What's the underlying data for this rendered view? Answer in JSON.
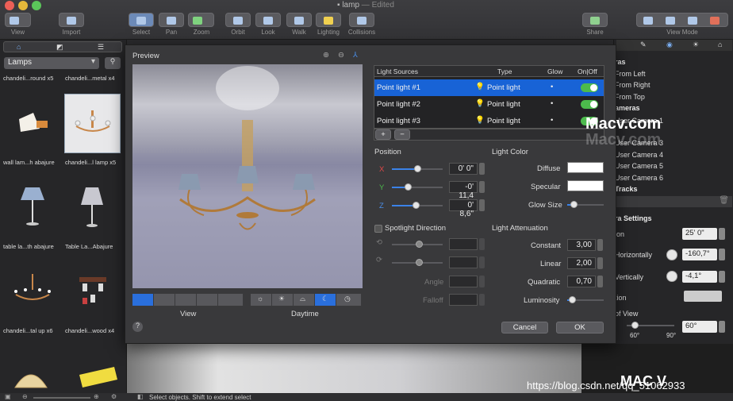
{
  "window": {
    "title": "lamp",
    "subtitle": "— Edited"
  },
  "toolbar": {
    "view": "View",
    "import": "Import",
    "select": "Select",
    "pan": "Pan",
    "zoom": "Zoom",
    "orbit": "Orbit",
    "look": "Look",
    "walk": "Walk",
    "lighting": "Lighting",
    "collisions": "Collisions",
    "share": "Share",
    "view_mode": "View Mode"
  },
  "library": {
    "category": "Lamps",
    "search_icon": "search-icon",
    "items": [
      {
        "label": "chandeli...round x5"
      },
      {
        "label": "chandeli...metal x4"
      },
      {
        "label": "wall lam...h abajure"
      },
      {
        "label": "chandeli...l lamp x5"
      },
      {
        "label": "table la...th abajure"
      },
      {
        "label": "Table La...Abajure"
      },
      {
        "label": "chandeli...tal up x6"
      },
      {
        "label": "chandeli...wood x4"
      }
    ]
  },
  "dialog": {
    "preview_label": "Preview",
    "list": {
      "headers": {
        "sources": "Light Sources",
        "type": "Type",
        "glow": "Glow",
        "onoff": "On|Off"
      },
      "rows": [
        {
          "name": "Point light #1",
          "type": "Point light"
        },
        {
          "name": "Point light #2",
          "type": "Point light"
        },
        {
          "name": "Point light #3",
          "type": "Point light"
        }
      ],
      "add": "+",
      "remove": "−"
    },
    "position": {
      "label": "Position",
      "x_label": "X",
      "y_label": "Y",
      "z_label": "Z",
      "x": "0' 0\"",
      "y": "-0' 11,4",
      "z": "0' 8,6\""
    },
    "spotlight": {
      "label": "Spotlight Direction",
      "angle": "Angle",
      "falloff": "Falloff"
    },
    "light_color": {
      "label": "Light Color",
      "diffuse": "Diffuse",
      "specular": "Specular",
      "glow_size": "Glow Size"
    },
    "attenuation": {
      "label": "Light Attenuation",
      "constant_label": "Constant",
      "constant": "3,00",
      "linear_label": "Linear",
      "linear": "2,00",
      "quadratic_label": "Quadratic",
      "quadratic": "0,70",
      "luminosity": "Luminosity"
    },
    "view_label": "View",
    "daytime_label": "Daytime",
    "cancel": "Cancel",
    "ok": "OK",
    "help": "?"
  },
  "right": {
    "rows": [
      {
        "text": "ras",
        "bold": true
      },
      {
        "text": "From Left"
      },
      {
        "text": "From Right"
      },
      {
        "text": "From Top"
      },
      {
        "text": "ameras",
        "bold": true
      },
      {
        "text": "User Camera 1"
      },
      {
        "text": "User Camera 3"
      },
      {
        "text": "User Camera 4"
      },
      {
        "text": "User Camera 5"
      },
      {
        "text": "User Camera 6"
      },
      {
        "text": "Tracks",
        "bold": true
      }
    ],
    "settings": "ra Settings",
    "ion": "ion",
    "ion_val": "25' 0\"",
    "horiz": "Horizontally",
    "horiz_val": "-160,7°",
    "vert": "Vertically",
    "vert_val": "-4,1°",
    "tion": "tion",
    "fov": "of View",
    "fov_val": "60°",
    "fov_min": "60°",
    "fov_max": "90°"
  },
  "status": {
    "text": "Select objects. Shift to extend select"
  },
  "watermark": {
    "brand": "Macv.com",
    "url": "https://blog.csdn.net/qq_51062933",
    "logo_text": "MAC V"
  }
}
